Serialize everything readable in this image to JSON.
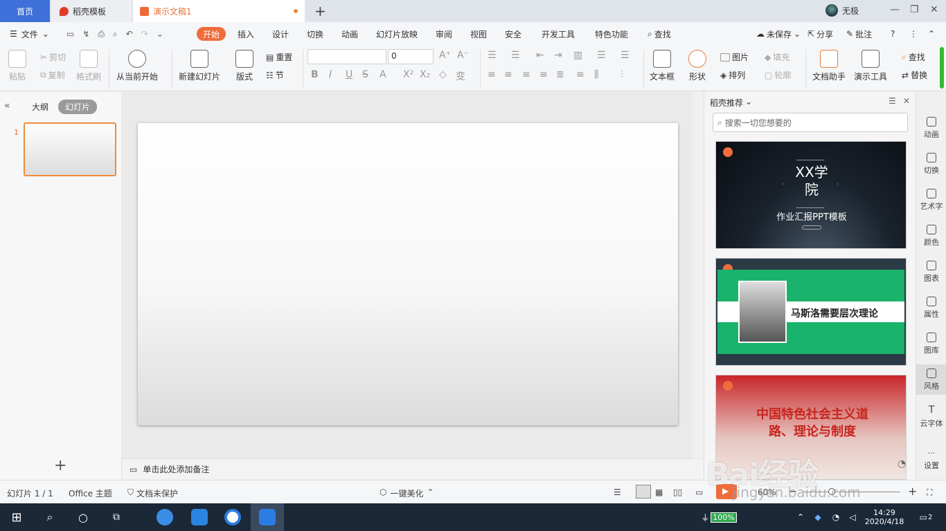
{
  "titlebar": {
    "tabs": [
      {
        "label": "首页"
      },
      {
        "label": "稻壳模板"
      },
      {
        "label": "演示文稿1"
      }
    ],
    "new_tab": "+",
    "user_name": "无极",
    "win_min": "—",
    "win_restore": "❐",
    "win_close": "✕"
  },
  "menubar": {
    "file": "文件",
    "items": [
      "开始",
      "插入",
      "设计",
      "切换",
      "动画",
      "幻灯片放映",
      "审阅",
      "视图",
      "安全",
      "开发工具",
      "特色功能"
    ],
    "search": "查找",
    "unsaved": "未保存",
    "share": "分享",
    "comment": "批注",
    "help": "?",
    "more": "⋮",
    "collapse": "⌃"
  },
  "ribbon": {
    "paste": "粘贴",
    "cut": "剪切",
    "copy": "复制",
    "format_painter": "格式刷",
    "start_from_current": "从当前开始",
    "new_slide": "新建幻灯片",
    "layout": "版式",
    "reset": "重置",
    "section": "节",
    "font_size": "0",
    "textbox": "文本框",
    "shape": "形状",
    "picture": "图片",
    "arrange": "排列",
    "fill": "填充",
    "outline": "轮廓",
    "doc_assistant": "文档助手",
    "presentation_tools": "演示工具",
    "find": "查找",
    "replace": "替换"
  },
  "left_panel": {
    "tab_outline": "大纲",
    "tab_slides": "幻灯片",
    "collapse": "«",
    "slide_number": "1",
    "add": "+"
  },
  "notes": {
    "placeholder": "单击此处添加备注"
  },
  "right_panel": {
    "title": "稻壳推荐",
    "search_placeholder": "搜索一切您想要的",
    "cards": [
      {
        "title": "XX学院",
        "subtitle": "作业汇报PPT模板"
      },
      {
        "title": "马斯洛需要层次理论"
      },
      {
        "title": "中国特色社会主义道路、理论与制度"
      }
    ]
  },
  "rail": [
    "动画",
    "切换",
    "艺术字",
    "颜色",
    "图表",
    "属性",
    "图库",
    "风格",
    "云字体",
    "设置"
  ],
  "status": {
    "slide_info": "幻灯片 1 / 1",
    "theme": "Office 主题",
    "protect": "文档未保护",
    "beautify": "一键美化",
    "zoom": "60%",
    "zoom_out": "−",
    "zoom_in": "+"
  },
  "taskbar": {
    "battery": "100%",
    "time": "14:29",
    "date": "2020/4/18",
    "notify_count": "2"
  },
  "watermark": {
    "brand": "Bai经验",
    "url": "jingyan.baidu.com"
  },
  "colors": {
    "accent": "#ef6c3c",
    "home_tab": "#3f6fd8",
    "taskbar": "#1b2838",
    "card2_green": "#19b36b"
  }
}
